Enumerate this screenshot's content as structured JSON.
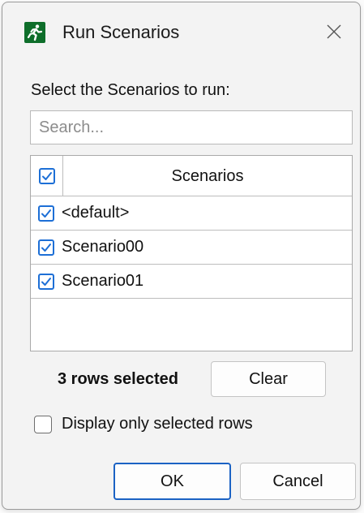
{
  "window": {
    "title": "Run Scenarios",
    "close_glyph": "✕",
    "icon": "running-man-icon"
  },
  "prompt": "Select the Scenarios to run:",
  "search": {
    "placeholder": "Search...",
    "value": ""
  },
  "table": {
    "header": {
      "label": "Scenarios",
      "checked": true
    },
    "rows": [
      {
        "label": "<default>",
        "checked": true
      },
      {
        "label": "Scenario00",
        "checked": true
      },
      {
        "label": "Scenario01",
        "checked": true
      }
    ]
  },
  "selection": {
    "status": "3 rows selected",
    "clear_label": "Clear"
  },
  "display_only_selected": {
    "label": "Display only selected rows",
    "checked": false
  },
  "buttons": {
    "ok": "OK",
    "cancel": "Cancel"
  },
  "colors": {
    "accent": "#1d6fd6",
    "app_icon_bg": "#0e6e2a"
  }
}
